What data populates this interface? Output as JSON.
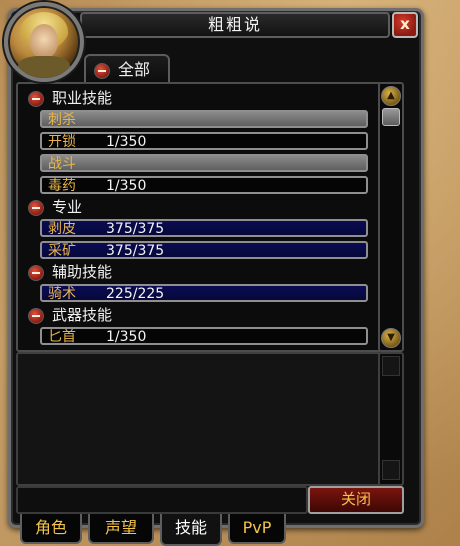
{
  "window": {
    "title": "粗粗说",
    "close_glyph": "x"
  },
  "top_tab": {
    "label": "全部"
  },
  "skills": {
    "class_header": "职业技能",
    "class_items": [
      {
        "name": "刺杀",
        "value": ""
      },
      {
        "name": "开锁",
        "value": "1/350"
      },
      {
        "name": "战斗",
        "value": ""
      },
      {
        "name": "毒药",
        "value": "1/350"
      }
    ],
    "prof_header": "专业",
    "prof_items": [
      {
        "name": "剥皮",
        "value": "375/375"
      },
      {
        "name": "采矿",
        "value": "375/375"
      }
    ],
    "sec_header": "辅助技能",
    "sec_items": [
      {
        "name": "骑术",
        "value": "225/225"
      }
    ],
    "weapon_header": "武器技能",
    "weapon_items": [
      {
        "name": "匕首",
        "value": "1/350"
      }
    ]
  },
  "footer": {
    "close_label": "关闭"
  },
  "bottom_tabs": [
    "角色",
    "声望",
    "技能",
    "PvP"
  ],
  "icons": {
    "collapse": "minus-icon",
    "scroll_up": "scroll-up-icon",
    "scroll_down": "scroll-down-icon"
  },
  "colors": {
    "gold_text": "#e8b54a",
    "bar_blue": "#0b0c52",
    "close_red": "#7a140e"
  }
}
